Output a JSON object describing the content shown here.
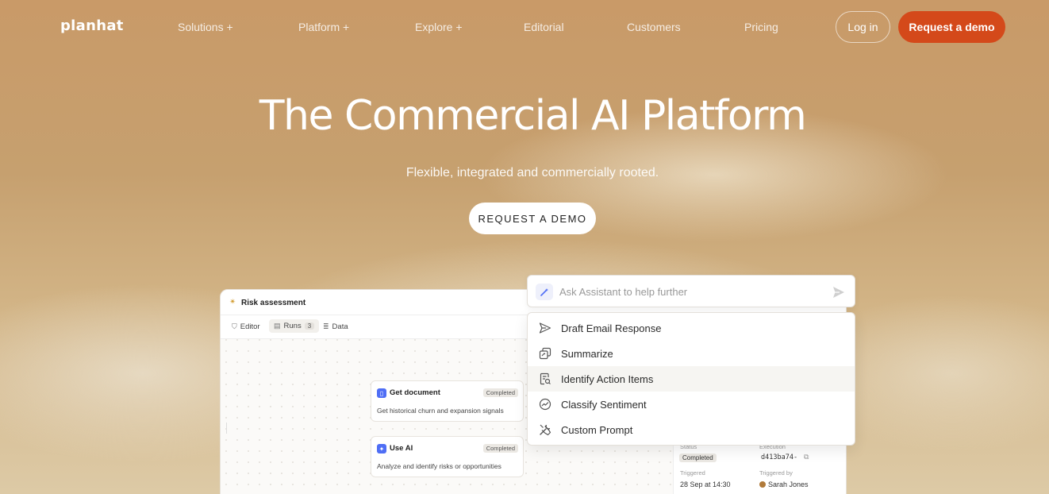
{
  "nav": {
    "logo": "planhat",
    "items": [
      "Solutions +",
      "Platform +",
      "Explore +",
      "Editorial",
      "Customers",
      "Pricing"
    ],
    "login": "Log in",
    "demo": "Request a demo"
  },
  "hero": {
    "title": "The Commercial AI Platform",
    "subtitle": "Flexible, integrated and commercially rooted.",
    "cta": "REQUEST A DEMO"
  },
  "app": {
    "title": "Risk assessment",
    "tabs": {
      "editor": "Editor",
      "runs": "Runs",
      "runs_count": "3",
      "data": "Data"
    },
    "nodes": [
      {
        "title": "Get document",
        "status": "Completed",
        "desc": "Get historical churn and expansion signals"
      },
      {
        "title": "Use AI",
        "status": "Completed",
        "desc": "Analyze and identify risks or opportunities"
      }
    ],
    "detail": {
      "status_label": "Status",
      "status": "Completed",
      "execution_label": "Execution",
      "execution": "d413ba74-",
      "triggered_label": "Triggered",
      "triggered": "28 Sep at 14:30",
      "triggered_by_label": "Triggered by",
      "triggered_by": "Sarah Jones"
    }
  },
  "assistant": {
    "placeholder": "Ask Assistant to help further",
    "menu": [
      {
        "label": "Draft Email Response",
        "icon": "send-icon"
      },
      {
        "label": "Summarize",
        "icon": "summarize-icon"
      },
      {
        "label": "Identify Action Items",
        "icon": "document-search-icon"
      },
      {
        "label": "Classify Sentiment",
        "icon": "sentiment-icon"
      },
      {
        "label": "Custom Prompt",
        "icon": "tools-icon"
      }
    ]
  },
  "colors": {
    "accent": "#d4491a",
    "ai_blue": "#4f6ef5"
  }
}
